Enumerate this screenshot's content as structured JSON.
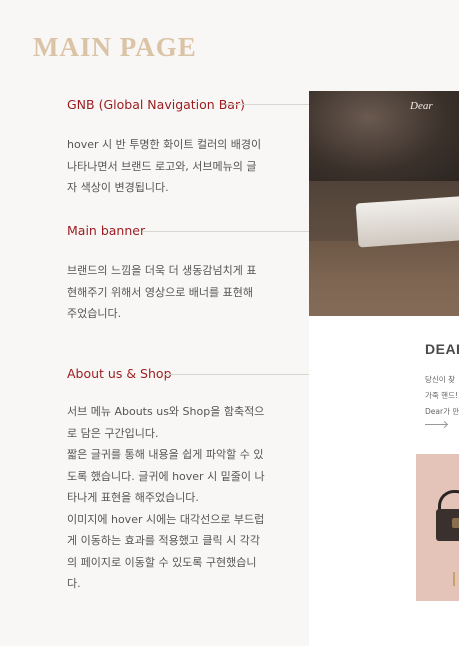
{
  "page": {
    "title": "MAIN PAGE"
  },
  "sections": [
    {
      "title": "GNB (Global Navigation Bar)",
      "lines": [
        "hover 시 반 투명한 화이트 컬러의 배경이",
        "나타나면서 브랜드 로고와, 서브메뉴의 글",
        "자 색상이 변경됩니다."
      ]
    },
    {
      "title": "Main banner",
      "lines": [
        "브랜드의 느낌을 더욱 더 생동감넘치게 표",
        "현해주기 위해서 영상으로 배너를 표현해",
        "주었습니다."
      ]
    },
    {
      "title": "About us & Shop",
      "lines": [
        "서브 메뉴 Abouts us와 Shop을 함축적으",
        "로 담은 구간입니다.",
        "짧은 글귀를 통해 내용을 쉽게 파악할 수 있",
        "도록 했습니다. 글귀에 hover 시 밑줄이 나",
        "타나게 표현을 해주었습니다.",
        "이미지에 hover 시에는 대각선으로 부드럽",
        "게 이동하는 효과를 적용했고 클릭 시 각각",
        "의 페이지로 이동할 수 있도록 구현했습니",
        "다."
      ]
    }
  ],
  "preview": {
    "brand_logo": "Dear",
    "about_title": "DEAR",
    "about_lines": [
      "당신이 찾",
      "가죽 핸드!",
      "Dear가 만"
    ]
  },
  "colors": {
    "accent": "#9b1b1f",
    "title": "#dbc4a6",
    "dot": "#b0171d"
  }
}
